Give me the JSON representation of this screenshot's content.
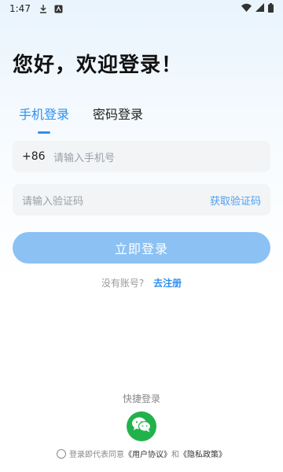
{
  "status_bar": {
    "time": "1:47",
    "icons_left": [
      "download-icon",
      "app-notification-icon"
    ],
    "icons_right": [
      "wifi-icon",
      "signal-icon",
      "battery-icon"
    ]
  },
  "greeting": "您好，欢迎登录！",
  "tabs": [
    {
      "label": "手机登录",
      "active": true
    },
    {
      "label": "密码登录",
      "active": false
    }
  ],
  "phone_field": {
    "prefix": "+86",
    "placeholder": "请输入手机号"
  },
  "code_field": {
    "placeholder": "请输入验证码",
    "action": "获取验证码"
  },
  "login_button": "立即登录",
  "register": {
    "prompt": "没有账号?",
    "link": "去注册"
  },
  "quick_login": {
    "label": "快捷登录",
    "icon": "wechat-icon"
  },
  "agreement": {
    "prefix": "登录即代表同意",
    "user_agreement": "《用户协议》",
    "and": "和",
    "privacy_policy": "《隐私政策》"
  },
  "colors": {
    "accent": "#2f8ff0",
    "button": "#8cc1f4",
    "wechat": "#22b24c",
    "field_bg": "#f2f4f6"
  }
}
